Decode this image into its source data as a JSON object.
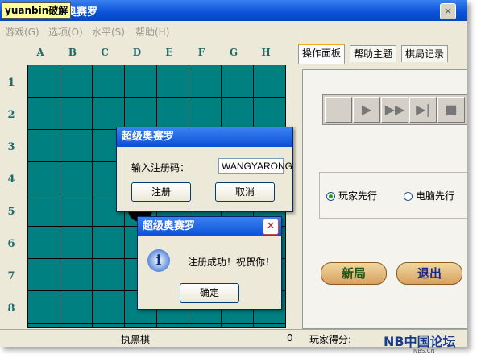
{
  "window": {
    "title": "超级奥赛罗",
    "watermark": "yuanbin破解"
  },
  "menu": [
    {
      "label": "游戏(G)"
    },
    {
      "label": "选项(O)"
    },
    {
      "label": "水平(S)"
    },
    {
      "label": "帮助(H)"
    }
  ],
  "board": {
    "columns": [
      "A",
      "B",
      "C",
      "D",
      "E",
      "F",
      "G",
      "H"
    ],
    "rows": [
      "1",
      "2",
      "3",
      "4",
      "5",
      "6",
      "7",
      "8"
    ],
    "colors": {
      "board": "#008080",
      "grid": "#000000"
    }
  },
  "tabs": [
    {
      "label": "操作面板",
      "active": true
    },
    {
      "label": "帮助主题",
      "active": false
    },
    {
      "label": "棋局记录",
      "active": false
    }
  ],
  "player_controls": [
    "blank-button",
    "play-icon",
    "fast-forward-icon",
    "skip-end-icon",
    "stop-icon"
  ],
  "turn_options": [
    {
      "label": "玩家先行",
      "selected": true
    },
    {
      "label": "电脑先行",
      "selected": false
    }
  ],
  "actions": {
    "new_game": "新局",
    "exit": "退出"
  },
  "status": {
    "left_fragment": "执黑棋",
    "middle_value": "0",
    "player_score_label": "玩家得分:"
  },
  "register_dialog": {
    "title": "超级奥赛罗",
    "prompt": "输入注册码：",
    "code": "WANGYARONG",
    "ok": "注册",
    "cancel": "取消"
  },
  "success_dialog": {
    "title": "超级奥赛罗",
    "message": "注册成功！祝贺你！",
    "ok": "确定"
  },
  "branding": {
    "logo": "NB中国论坛",
    "logo_sub": "NBS.CN"
  }
}
